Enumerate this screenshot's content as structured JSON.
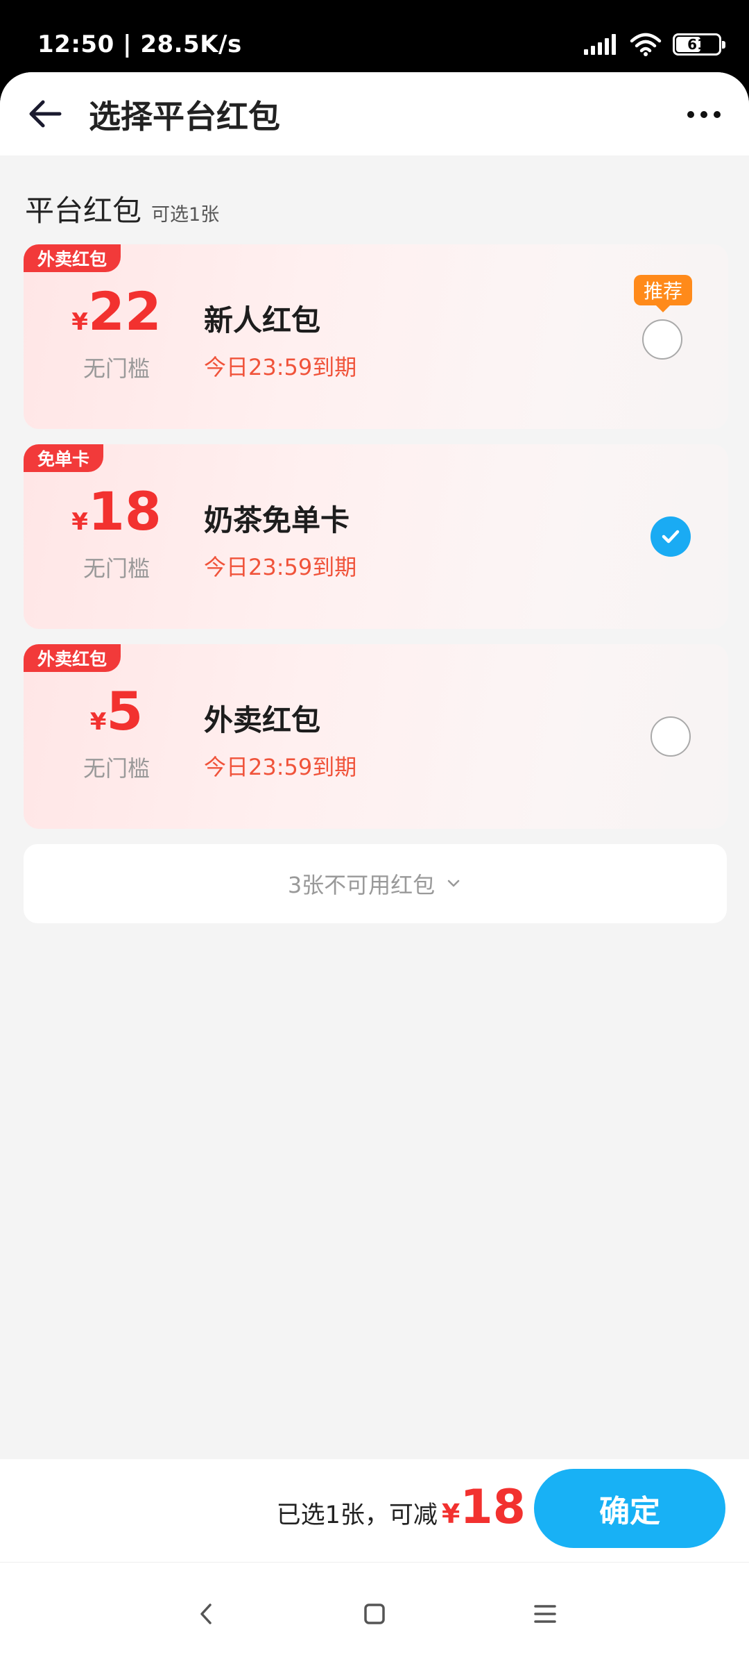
{
  "status_bar": {
    "time_speed": "12:50 | 28.5K/s",
    "battery_level": 61,
    "battery_text": "61"
  },
  "header": {
    "title": "选择平台红包"
  },
  "section": {
    "title": "平台红包",
    "hint": "可选1张"
  },
  "coupons": [
    {
      "tag": "外卖红包",
      "currency": "¥",
      "amount": "22",
      "threshold": "无门槛",
      "name": "新人红包",
      "expire": "今日23:59到期",
      "badge": "推荐",
      "selected": false
    },
    {
      "tag": "免单卡",
      "currency": "¥",
      "amount": "18",
      "threshold": "无门槛",
      "name": "奶茶免单卡",
      "expire": "今日23:59到期",
      "selected": true
    },
    {
      "tag": "外卖红包",
      "currency": "¥",
      "amount": "5",
      "threshold": "无门槛",
      "name": "外卖红包",
      "expire": "今日23:59到期",
      "selected": false
    }
  ],
  "unavailable": {
    "label": "3张不可用红包"
  },
  "bottom": {
    "summary_label": "已选1张，可减",
    "currency": "¥",
    "discount": "18",
    "confirm_label": "确定"
  },
  "colors": {
    "accent_red": "#f2312f",
    "tag_red": "#f23a3a",
    "confirm_blue": "#18b1f5",
    "recommend_orange": "#ff8a1a"
  },
  "icons": {
    "back": "arrow-left-icon",
    "more": "more-dots-icon",
    "check": "check-icon",
    "expand": "chevron-down-icon",
    "nav_back": "nav-back-icon",
    "nav_home": "nav-home-icon",
    "nav_menu": "nav-menu-icon"
  }
}
